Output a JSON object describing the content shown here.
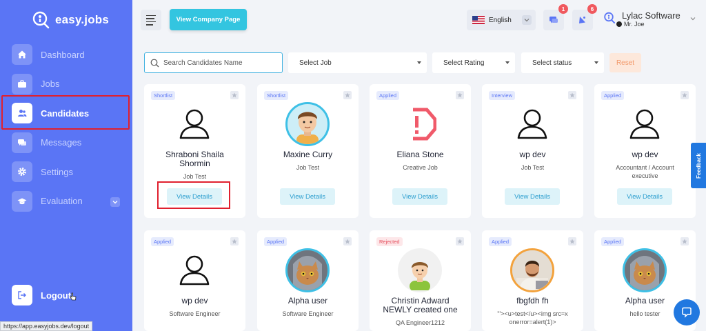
{
  "brand": {
    "name": "easy.jobs"
  },
  "nav": [
    {
      "label": "Dashboard",
      "icon": "home-icon",
      "active": false
    },
    {
      "label": "Jobs",
      "icon": "briefcase-icon",
      "active": false
    },
    {
      "label": "Candidates",
      "icon": "users-icon",
      "active": true
    },
    {
      "label": "Messages",
      "icon": "chat-icon",
      "active": false
    },
    {
      "label": "Settings",
      "icon": "gear-icon",
      "active": false
    },
    {
      "label": "Evaluation",
      "icon": "graduation-cap-icon",
      "active": false
    }
  ],
  "logout_label": "Logout",
  "statusbar_url": "https://app.easyjobs.dev/logout",
  "topbar": {
    "company_button": "View Company Page",
    "language": "English",
    "messages_badge": "1",
    "notifications_badge": "6",
    "company_name": "Lylac Software",
    "user_name": "Mr. Joe"
  },
  "filters": {
    "search_placeholder": "Search Candidates Name",
    "select_job": "Select Job",
    "select_rating": "Select Rating",
    "select_status": "Select status",
    "reset": "Reset"
  },
  "view_details_label": "View Details",
  "candidates": [
    {
      "status": "Shortlist",
      "name": "Shraboni Shaila Shormin",
      "job": "Job Test",
      "avatar": "placeholder"
    },
    {
      "status": "Shortlist",
      "name": "Maxine Curry",
      "job": "Job Test",
      "avatar": "cartoon-man"
    },
    {
      "status": "Applied",
      "name": "Eliana Stone",
      "job": "Creative Job",
      "avatar": "error"
    },
    {
      "status": "Interview",
      "name": "wp dev",
      "job": "Job Test",
      "avatar": "placeholder"
    },
    {
      "status": "Applied",
      "name": "wp dev",
      "job": "Accountant / Account executive",
      "avatar": "placeholder"
    },
    {
      "status": "Applied",
      "name": "wp dev",
      "job": "Software Engineer",
      "avatar": "placeholder"
    },
    {
      "status": "Applied",
      "name": "Alpha user",
      "job": "Software Engineer",
      "avatar": "cat"
    },
    {
      "status": "Rejected",
      "name": "Christin Adward NEWLY created one",
      "job": "QA Engineer1212",
      "avatar": "cartoon-boy"
    },
    {
      "status": "Applied",
      "name": "fbgfdh fh",
      "job": "\"'><u>test</u><img src=x onerror=alert(1)>",
      "avatar": "photo-man"
    },
    {
      "status": "Applied",
      "name": "Alpha user",
      "job": "hello tester",
      "avatar": "cat"
    }
  ],
  "feedback_label": "Feedback",
  "colors": {
    "sidebar": "#5a75f5",
    "accent": "#33c5e0",
    "highlight": "#e0202e"
  }
}
